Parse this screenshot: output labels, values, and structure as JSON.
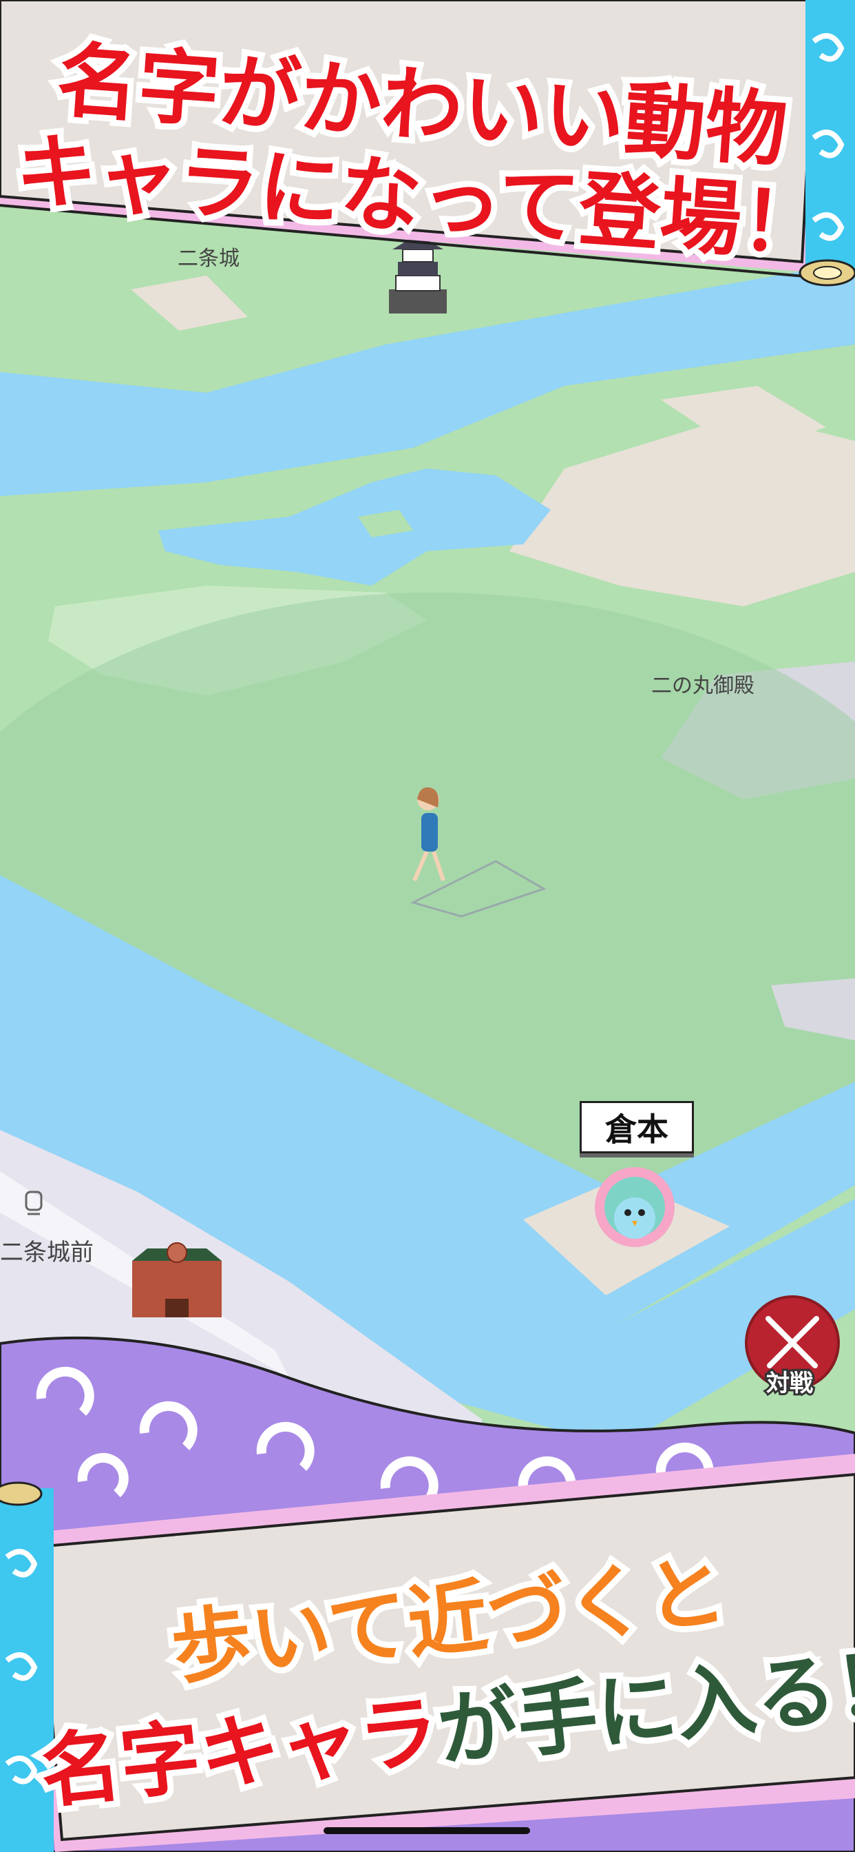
{
  "top_banner": {
    "line1": "名字がかわいい動物",
    "line2": "キャラになって登場！"
  },
  "map": {
    "labels": {
      "nijojo": "二条城",
      "ninomaru": "二の丸御殿",
      "nijojo_mae": "二条城前"
    }
  },
  "character": {
    "name_tag": "倉本",
    "icon": "peacock-character-icon"
  },
  "player": {
    "icon": "walking-woman-icon"
  },
  "battle_button": {
    "label": "対戦",
    "icon": "crossed-swords-icon"
  },
  "bottom_banner": {
    "line1": "歩いて近づくと",
    "line2_part1": "名字キャラ",
    "line2_part2": "が手に入る！"
  },
  "colors": {
    "banner_text_red": "#e8141e",
    "banner_text_orange": "#f5821f",
    "banner_text_green": "#2f5a3a",
    "scroll_paper": "#e6e1dc",
    "scroll_pink": "#f3b9e6",
    "scroll_blue": "#3ec7ef",
    "swirl_purple": "#a889e6",
    "river_blue": "#93d4f7",
    "grass_green": "#a8dca8",
    "battle_red": "#b8232f"
  }
}
